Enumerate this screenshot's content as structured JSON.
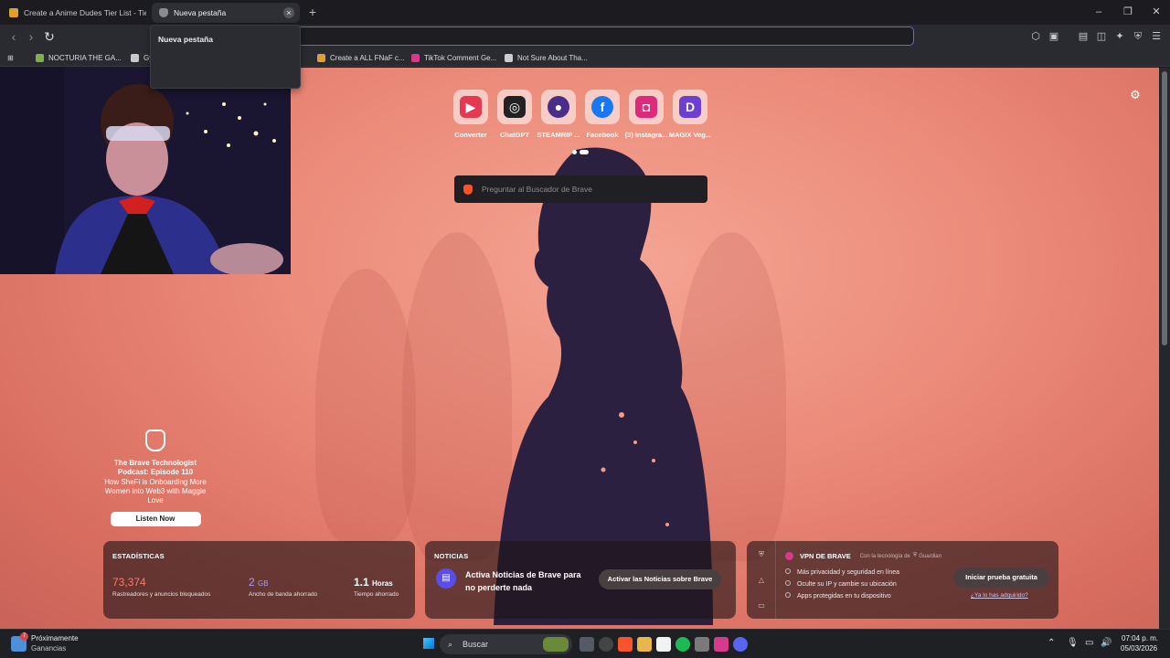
{
  "tabs": [
    {
      "label": "Create a Anime Dudes Tier List - TierMaker",
      "active": false
    },
    {
      "label": "Nueva pestaña",
      "active": true
    }
  ],
  "tooltip": "Nueva pestaña",
  "bookmarks": [
    {
      "label": "NOCTURIA THE GA...",
      "color": "#7fae4a"
    },
    {
      "label": "Gy...",
      "color": "#c8c8c8"
    },
    {
      "label": "Create a ALL FNaF c...",
      "color": "#e0a030"
    },
    {
      "label": "TikTok Comment Ge...",
      "color": "#d63a8b"
    },
    {
      "label": "Not Sure About Tha...",
      "color": "#cccccc"
    }
  ],
  "shortcuts": [
    {
      "label": "Converter",
      "glyph": "▶",
      "color": "#e53952"
    },
    {
      "label": "ChatGPT",
      "glyph": "◎",
      "color": "#222222"
    },
    {
      "label": "STEAMRIP ...",
      "glyph": "●",
      "color": "#4a2c8a"
    },
    {
      "label": "Facebook",
      "glyph": "f",
      "color": "#1877f2"
    },
    {
      "label": "(3) Instagra...",
      "glyph": "◘",
      "color": "#dd2a7b"
    },
    {
      "label": "MAGIX Veg...",
      "glyph": "D",
      "color": "#6b3fd1"
    }
  ],
  "search": {
    "placeholder": "Preguntar al Buscador de Brave"
  },
  "promo": {
    "title": "The Brave Technologist Podcast: Episode 110",
    "subtitle": "How SheFi is Onboarding More Women into Web3 with Maggie Love",
    "button": "Listen Now"
  },
  "stats": {
    "heading": "ESTADÍSTICAS",
    "trackers": {
      "value": "73,374",
      "caption": "Rastreadores y anuncios bloqueados"
    },
    "bandwidth": {
      "value": "2",
      "unit": "GB",
      "caption": "Ancho de banda ahorrado"
    },
    "time": {
      "value": "1.1",
      "unit": "Horas",
      "caption": "Tiempo ahorrado"
    }
  },
  "news": {
    "heading": "NOTICIAS",
    "text": "Activa Noticias de Brave para no perderte nada",
    "button": "Activar las Noticias sobre Brave"
  },
  "vpn": {
    "heading": "VPN DE BRAVE",
    "powered": "Con la tecnología de",
    "brand": "Guardian",
    "features": [
      "Más privacidad y seguridad en línea",
      "Oculte su IP y cambie su ubicación",
      "Apps protegidas en tu dispositivo"
    ],
    "button": "Iniciar prueba gratuita",
    "link": "¿Ya lo has adquirido?"
  },
  "taskbar": {
    "weather_title": "Próximamente",
    "weather_sub": "Ganancias",
    "badge": "7",
    "search": "Buscar",
    "time": "07:04 p. m.",
    "date": "05/03/2026"
  },
  "colors": {
    "accent": "#6d5dfc",
    "brave": "#fb542b"
  }
}
